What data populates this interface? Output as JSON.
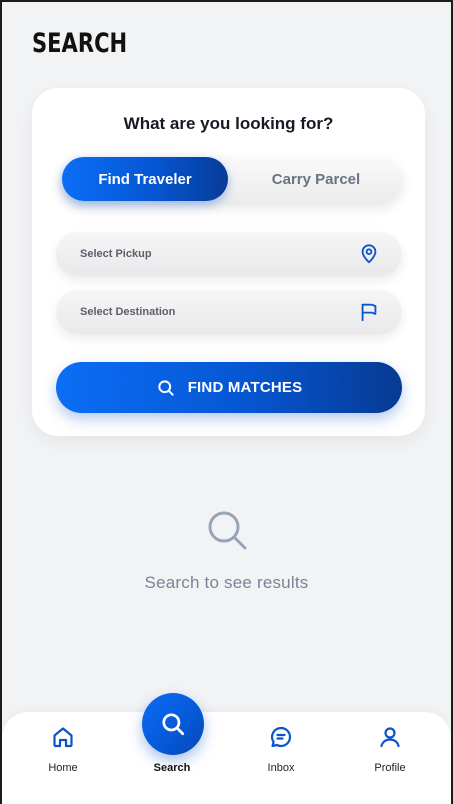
{
  "header": {
    "title": "SEARCH"
  },
  "card": {
    "heading": "What are you looking for?",
    "toggle": {
      "active": "Find Traveler",
      "inactive": "Carry Parcel"
    },
    "pickup": {
      "label": "Select Pickup",
      "icon": "map-pin-icon"
    },
    "destination": {
      "label": "Select Destination",
      "icon": "flag-icon"
    },
    "find_button": {
      "label": "FIND MATCHES",
      "icon": "search-icon"
    }
  },
  "empty_state": {
    "icon": "search-icon",
    "text": "Search to see results"
  },
  "bottom_nav": {
    "items": [
      {
        "label": "Home",
        "icon": "home-icon",
        "active": false
      },
      {
        "label": "Search",
        "icon": "search-icon",
        "active": true
      },
      {
        "label": "Inbox",
        "icon": "message-icon",
        "active": false
      },
      {
        "label": "Profile",
        "icon": "user-icon",
        "active": false
      }
    ]
  },
  "colors": {
    "accent": "#0656d3",
    "accent_light": "#0b6ef5",
    "background": "#f2f3f5",
    "muted_text": "#7a8496"
  }
}
